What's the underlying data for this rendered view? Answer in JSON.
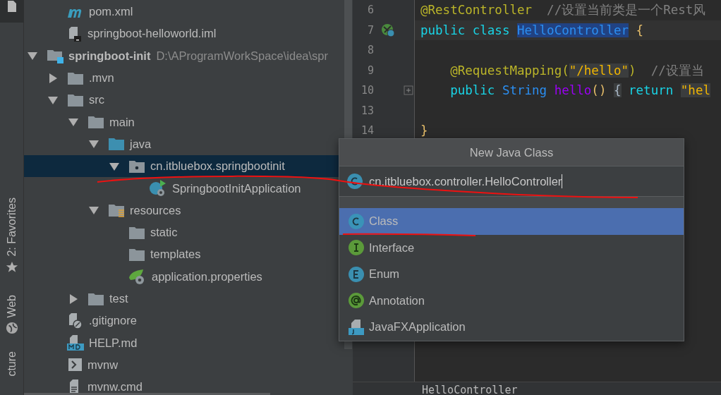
{
  "tool_strip": [
    {
      "label": "2: Favorites",
      "kind": "favorites"
    },
    {
      "label": "Web",
      "kind": "web"
    },
    {
      "label": "cture",
      "kind": "structure"
    }
  ],
  "project_tree": {
    "parent_children": [
      {
        "name": "pom.xml",
        "kind": "maven"
      },
      {
        "name": "springboot-helloworld.iml",
        "kind": "iml"
      }
    ],
    "items": [
      {
        "name": "springboot-init",
        "path": "D:\\AProgramWorkSpace\\idea\\spr",
        "kind": "module",
        "expanded": true,
        "selected": false,
        "children": [
          {
            "name": ".mvn",
            "kind": "folder",
            "expanded": false,
            "selected": false
          },
          {
            "name": "src",
            "kind": "folder",
            "expanded": true,
            "selected": false,
            "children": [
              {
                "name": "main",
                "kind": "folder",
                "expanded": true,
                "selected": false,
                "children": [
                  {
                    "name": "java",
                    "kind": "source",
                    "expanded": true,
                    "selected": false,
                    "children": [
                      {
                        "name": "cn.itbluebox.springbootinit",
                        "kind": "package",
                        "expanded": true,
                        "selected": true,
                        "children": [
                          {
                            "name": "SpringbootInitApplication",
                            "kind": "boot-class",
                            "selected": false
                          }
                        ]
                      }
                    ]
                  },
                  {
                    "name": "resources",
                    "kind": "resources",
                    "expanded": true,
                    "selected": false,
                    "children": [
                      {
                        "name": "static",
                        "kind": "folder",
                        "selected": false
                      },
                      {
                        "name": "templates",
                        "kind": "folder",
                        "selected": false
                      },
                      {
                        "name": "application.properties",
                        "kind": "properties",
                        "selected": false
                      }
                    ]
                  }
                ]
              },
              {
                "name": "test",
                "kind": "folder",
                "expanded": false,
                "selected": false
              }
            ]
          },
          {
            "name": ".gitignore",
            "kind": "gitignore",
            "selected": false
          },
          {
            "name": "HELP.md",
            "kind": "markdown",
            "selected": false
          },
          {
            "name": "mvnw",
            "kind": "shell",
            "selected": false
          },
          {
            "name": "mvnw.cmd",
            "kind": "text",
            "selected": false
          }
        ]
      }
    ]
  },
  "editor": {
    "lines": [
      {
        "number": "6",
        "tokens": [
          {
            "text": "@RestController",
            "kind": "annotation"
          },
          {
            "text": "  //设置当前类是一个Rest风",
            "kind": "comment"
          }
        ]
      },
      {
        "number": "7",
        "current": true,
        "class_marker": true,
        "tokens": [
          {
            "text": "public class ",
            "kind": "keyword"
          },
          {
            "text": "HelloController",
            "kind": "selected-type"
          },
          {
            "text": " {",
            "kind": "brace"
          }
        ]
      },
      {
        "number": "8"
      },
      {
        "number": "9",
        "tokens": [
          {
            "text": "    @RequestMapping(",
            "kind": "annotation"
          },
          {
            "text": "\"/hello\"",
            "kind": "string"
          },
          {
            "text": ")",
            "kind": "annotation"
          },
          {
            "text": "  //设置当",
            "kind": "comment"
          }
        ]
      },
      {
        "number": "10",
        "fold": true,
        "tokens": [
          {
            "text": "    public ",
            "kind": "keyword"
          },
          {
            "text": "String ",
            "kind": "type"
          },
          {
            "text": "hello",
            "kind": "method"
          },
          {
            "text": "() ",
            "kind": "brace"
          },
          {
            "text": "{",
            "kind": "folded"
          },
          {
            "text": " return ",
            "kind": "keyword"
          },
          {
            "text": "\"hel",
            "kind": "string"
          }
        ]
      },
      {
        "number": "13"
      },
      {
        "number": "14",
        "tokens": [
          {
            "text": "}",
            "kind": "brace"
          }
        ]
      }
    ],
    "breadcrumb": "HelloController"
  },
  "dialog": {
    "title": "New Java Class",
    "name_field": {
      "value": "cn.itbluebox.controller.HelloController"
    },
    "kinds": [
      {
        "label": "Class",
        "kind": "class",
        "selected": true
      },
      {
        "label": "Interface",
        "kind": "interface",
        "selected": false
      },
      {
        "label": "Enum",
        "kind": "enum",
        "selected": false
      },
      {
        "label": "Annotation",
        "kind": "annotation",
        "selected": false
      },
      {
        "label": "JavaFXApplication",
        "kind": "javafx",
        "selected": false
      }
    ]
  }
}
